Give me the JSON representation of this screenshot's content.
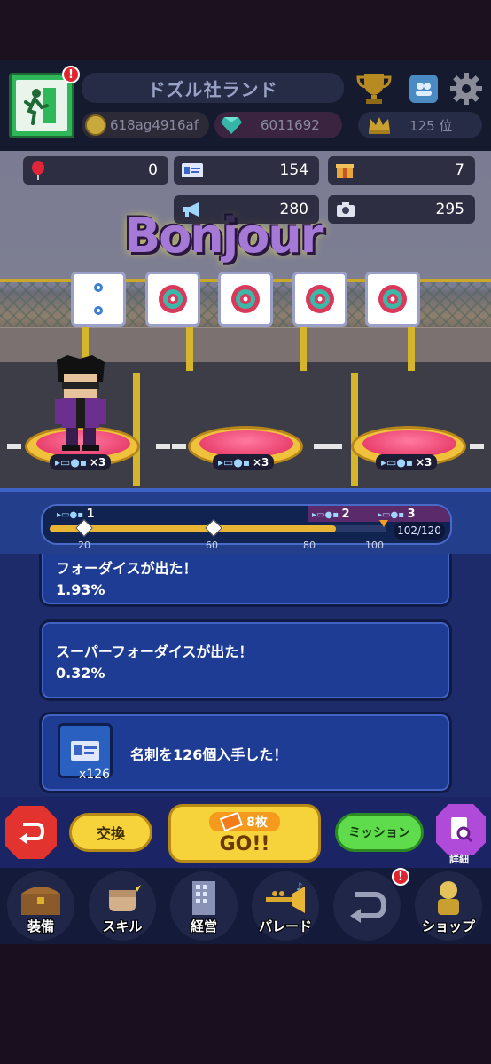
{
  "header": {
    "title": "ドズル社ランド",
    "coins": "618ag4916af",
    "gems": "6011692",
    "rank": "125 位",
    "exit_badge": "!"
  },
  "stats": {
    "balloons": "0",
    "cards": "154",
    "boxes": "7",
    "megaphone": "280",
    "camera": "295"
  },
  "scene": {
    "logo": "Bonjour",
    "pad_multiplier": "×3"
  },
  "progress": {
    "stage1": "1",
    "stage2": "2",
    "stage3": "3",
    "ticks": [
      "20",
      "60",
      "80",
      "100"
    ],
    "count": "102/120",
    "value": 102,
    "max": 120
  },
  "log": [
    {
      "line1": "フォーダイスが出た！",
      "line2": "1.93%"
    },
    {
      "line1": "スーパーフォーダイスが出た！",
      "line2": "0.32%"
    },
    {
      "line1": "名刺を126個入手した！",
      "qty": "x126"
    }
  ],
  "actions": {
    "exchange": "交換",
    "tickets": "8枚",
    "go": "GO!!",
    "mission": "ミッション",
    "detail": "詳細"
  },
  "nav": {
    "equip": "装備",
    "skill": "スキル",
    "manage": "経営",
    "parade": "パレード",
    "shop": "ショップ"
  },
  "colors": {
    "accent_gold": "#e8b535",
    "panel_blue": "#1f3c94",
    "go_yellow": "#f6d33a",
    "mission_green": "#5fdc4c",
    "detail_purple": "#b04ad8",
    "back_red": "#e2332e"
  }
}
